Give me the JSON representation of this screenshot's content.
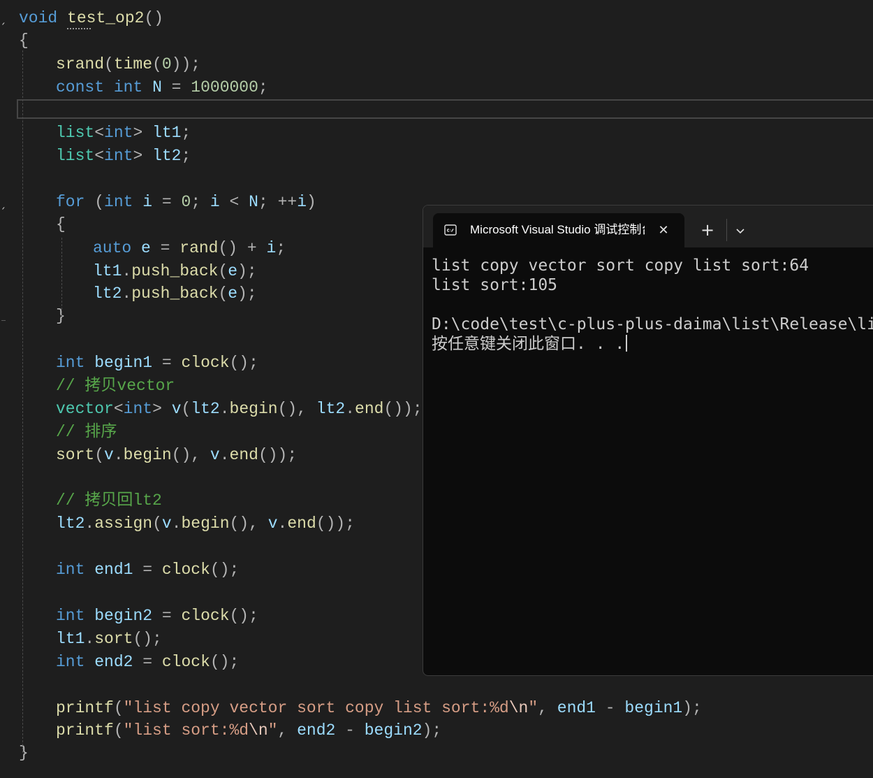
{
  "editor": {
    "lines": [
      [
        [
          "kw",
          "void"
        ],
        [
          "pn",
          " "
        ],
        [
          "fn",
          "test_op2"
        ],
        [
          "pn",
          "()"
        ]
      ],
      [
        [
          "pn",
          "{"
        ]
      ],
      [
        [
          "fn",
          "srand"
        ],
        [
          "pn",
          "("
        ],
        [
          "fn",
          "time"
        ],
        [
          "pn",
          "("
        ],
        [
          "nm",
          "0"
        ],
        [
          "pn",
          "));"
        ]
      ],
      [
        [
          "kw",
          "const"
        ],
        [
          "pn",
          " "
        ],
        [
          "kw",
          "int"
        ],
        [
          "pn",
          " "
        ],
        [
          "id",
          "N"
        ],
        [
          "op",
          " = "
        ],
        [
          "nm",
          "1000000"
        ],
        [
          "pn",
          ";"
        ]
      ],
      [],
      [
        [
          "ty",
          "list"
        ],
        [
          "op",
          "<"
        ],
        [
          "kw",
          "int"
        ],
        [
          "op",
          ">"
        ],
        [
          "pn",
          " "
        ],
        [
          "id",
          "lt1"
        ],
        [
          "pn",
          ";"
        ]
      ],
      [
        [
          "ty",
          "list"
        ],
        [
          "op",
          "<"
        ],
        [
          "kw",
          "int"
        ],
        [
          "op",
          ">"
        ],
        [
          "pn",
          " "
        ],
        [
          "id",
          "lt2"
        ],
        [
          "pn",
          ";"
        ]
      ],
      [],
      [
        [
          "kw",
          "for"
        ],
        [
          "pn",
          " ("
        ],
        [
          "kw",
          "int"
        ],
        [
          "pn",
          " "
        ],
        [
          "id",
          "i"
        ],
        [
          "op",
          " = "
        ],
        [
          "nm",
          "0"
        ],
        [
          "pn",
          "; "
        ],
        [
          "id",
          "i"
        ],
        [
          "op",
          " < "
        ],
        [
          "id",
          "N"
        ],
        [
          "pn",
          "; "
        ],
        [
          "op",
          "++"
        ],
        [
          "id",
          "i"
        ],
        [
          "pn",
          ")"
        ]
      ],
      [
        [
          "pn",
          "{"
        ]
      ],
      [
        [
          "kw",
          "auto"
        ],
        [
          "pn",
          " "
        ],
        [
          "id",
          "e"
        ],
        [
          "op",
          " = "
        ],
        [
          "fn",
          "rand"
        ],
        [
          "pn",
          "()"
        ],
        [
          "op",
          " + "
        ],
        [
          "id",
          "i"
        ],
        [
          "pn",
          ";"
        ]
      ],
      [
        [
          "id",
          "lt1"
        ],
        [
          "pn",
          "."
        ],
        [
          "fn",
          "push_back"
        ],
        [
          "pn",
          "("
        ],
        [
          "id",
          "e"
        ],
        [
          "pn",
          ");"
        ]
      ],
      [
        [
          "id",
          "lt2"
        ],
        [
          "pn",
          "."
        ],
        [
          "fn",
          "push_back"
        ],
        [
          "pn",
          "("
        ],
        [
          "id",
          "e"
        ],
        [
          "pn",
          ");"
        ]
      ],
      [
        [
          "pn",
          "}"
        ]
      ],
      [],
      [
        [
          "kw",
          "int"
        ],
        [
          "pn",
          " "
        ],
        [
          "id",
          "begin1"
        ],
        [
          "op",
          " = "
        ],
        [
          "fn",
          "clock"
        ],
        [
          "pn",
          "();"
        ]
      ],
      [
        [
          "cm",
          "// 拷贝vector"
        ]
      ],
      [
        [
          "ty",
          "vector"
        ],
        [
          "op",
          "<"
        ],
        [
          "kw",
          "int"
        ],
        [
          "op",
          ">"
        ],
        [
          "pn",
          " "
        ],
        [
          "id",
          "v"
        ],
        [
          "pn",
          "("
        ],
        [
          "id",
          "lt2"
        ],
        [
          "pn",
          "."
        ],
        [
          "fn",
          "begin"
        ],
        [
          "pn",
          "(), "
        ],
        [
          "id",
          "lt2"
        ],
        [
          "pn",
          "."
        ],
        [
          "fn",
          "end"
        ],
        [
          "pn",
          "());"
        ]
      ],
      [
        [
          "cm",
          "// 排序"
        ]
      ],
      [
        [
          "fn",
          "sort"
        ],
        [
          "pn",
          "("
        ],
        [
          "id",
          "v"
        ],
        [
          "pn",
          "."
        ],
        [
          "fn",
          "begin"
        ],
        [
          "pn",
          "(), "
        ],
        [
          "id",
          "v"
        ],
        [
          "pn",
          "."
        ],
        [
          "fn",
          "end"
        ],
        [
          "pn",
          "());"
        ]
      ],
      [],
      [
        [
          "cm",
          "// 拷贝回lt2"
        ]
      ],
      [
        [
          "id",
          "lt2"
        ],
        [
          "pn",
          "."
        ],
        [
          "fn",
          "assign"
        ],
        [
          "pn",
          "("
        ],
        [
          "id",
          "v"
        ],
        [
          "pn",
          "."
        ],
        [
          "fn",
          "begin"
        ],
        [
          "pn",
          "(), "
        ],
        [
          "id",
          "v"
        ],
        [
          "pn",
          "."
        ],
        [
          "fn",
          "end"
        ],
        [
          "pn",
          "());"
        ]
      ],
      [],
      [
        [
          "kw",
          "int"
        ],
        [
          "pn",
          " "
        ],
        [
          "id",
          "end1"
        ],
        [
          "op",
          " = "
        ],
        [
          "fn",
          "clock"
        ],
        [
          "pn",
          "();"
        ]
      ],
      [],
      [
        [
          "kw",
          "int"
        ],
        [
          "pn",
          " "
        ],
        [
          "id",
          "begin2"
        ],
        [
          "op",
          " = "
        ],
        [
          "fn",
          "clock"
        ],
        [
          "pn",
          "();"
        ]
      ],
      [
        [
          "id",
          "lt1"
        ],
        [
          "pn",
          "."
        ],
        [
          "fn",
          "sort"
        ],
        [
          "pn",
          "();"
        ]
      ],
      [
        [
          "kw",
          "int"
        ],
        [
          "pn",
          " "
        ],
        [
          "id",
          "end2"
        ],
        [
          "op",
          " = "
        ],
        [
          "fn",
          "clock"
        ],
        [
          "pn",
          "();"
        ]
      ],
      [],
      [
        [
          "fn",
          "printf"
        ],
        [
          "pn",
          "("
        ],
        [
          "st",
          "\"list copy vector sort copy list sort:%d"
        ],
        [
          "es",
          "\\n"
        ],
        [
          "st",
          "\""
        ],
        [
          "pn",
          ", "
        ],
        [
          "id",
          "end1"
        ],
        [
          "op",
          " - "
        ],
        [
          "id",
          "begin1"
        ],
        [
          "pn",
          ");"
        ]
      ],
      [
        [
          "fn",
          "printf"
        ],
        [
          "pn",
          "("
        ],
        [
          "st",
          "\"list sort:%d"
        ],
        [
          "es",
          "\\n"
        ],
        [
          "st",
          "\""
        ],
        [
          "pn",
          ", "
        ],
        [
          "id",
          "end2"
        ],
        [
          "op",
          " - "
        ],
        [
          "id",
          "begin2"
        ],
        [
          "pn",
          ");"
        ]
      ],
      [
        [
          "pn",
          "}"
        ]
      ]
    ]
  },
  "console": {
    "title": "Microsoft Visual Studio 调试控制台",
    "close_glyph": "✕",
    "new_tab_glyph": "+",
    "output": [
      "list copy vector sort copy list sort:64",
      "list sort:105",
      "",
      "D:\\code\\test\\c-plus-plus-daima\\list\\Release\\list.exe",
      "按任意键关闭此窗口. . ."
    ]
  }
}
